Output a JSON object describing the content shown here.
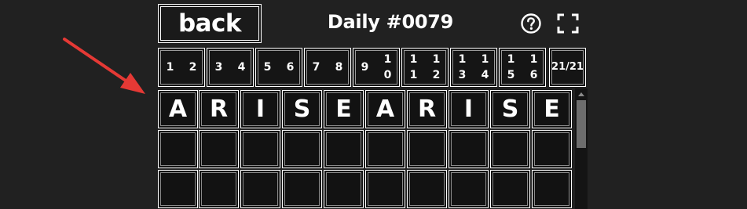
{
  "header": {
    "back_label": "back",
    "title": "Daily #0079",
    "help_icon": "question-circle-icon",
    "fullscreen_icon": "fullscreen-icon"
  },
  "board_tabs": [
    {
      "labels": [
        "1",
        "2"
      ]
    },
    {
      "labels": [
        "3",
        "4"
      ]
    },
    {
      "labels": [
        "5",
        "6"
      ]
    },
    {
      "labels": [
        "7",
        "8"
      ]
    },
    {
      "labels": [
        "9",
        "1",
        "0"
      ]
    },
    {
      "labels": [
        "1",
        "1",
        "1",
        "2"
      ]
    },
    {
      "labels": [
        "1",
        "3",
        "1",
        "4"
      ]
    },
    {
      "labels": [
        "1",
        "5",
        "1",
        "6"
      ]
    }
  ],
  "progress": "21/21",
  "guesses": [
    [
      "A",
      "R",
      "I",
      "S",
      "E",
      "A",
      "R",
      "I",
      "S",
      "E"
    ],
    [
      "",
      "",
      "",
      "",
      "",
      "",
      "",
      "",
      "",
      ""
    ],
    [
      "",
      "",
      "",
      "",
      "",
      "",
      "",
      "",
      "",
      ""
    ]
  ],
  "colors": {
    "background": "#212121",
    "arrow": "#e53935"
  }
}
